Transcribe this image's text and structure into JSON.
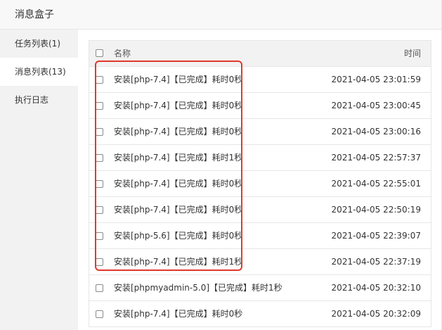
{
  "window": {
    "title": "消息盒子"
  },
  "sidebar": {
    "items": [
      {
        "label": "任务列表(1)",
        "active": false
      },
      {
        "label": "消息列表(13)",
        "active": true
      },
      {
        "label": "执行日志",
        "active": false
      }
    ]
  },
  "table": {
    "header": {
      "name": "名称",
      "time": "时间"
    },
    "rows": [
      {
        "name": "安装[php-7.4]【已完成】耗时0秒",
        "time": "2021-04-05 23:01:59"
      },
      {
        "name": "安装[php-7.4]【已完成】耗时0秒",
        "time": "2021-04-05 23:00:45"
      },
      {
        "name": "安装[php-7.4]【已完成】耗时0秒",
        "time": "2021-04-05 23:00:16"
      },
      {
        "name": "安装[php-7.4]【已完成】耗时1秒",
        "time": "2021-04-05 22:57:37"
      },
      {
        "name": "安装[php-7.4]【已完成】耗时0秒",
        "time": "2021-04-05 22:55:01"
      },
      {
        "name": "安装[php-7.4]【已完成】耗时0秒",
        "time": "2021-04-05 22:50:19"
      },
      {
        "name": "安装[php-5.6]【已完成】耗时0秒",
        "time": "2021-04-05 22:39:07"
      },
      {
        "name": "安装[php-7.4]【已完成】耗时1秒",
        "time": "2021-04-05 22:37:19"
      },
      {
        "name": "安装[phpmyadmin-5.0]【已完成】耗时1秒",
        "time": "2021-04-05 20:32:10"
      },
      {
        "name": "安装[php-7.4]【已完成】耗时0秒",
        "time": "2021-04-05 20:32:09"
      }
    ]
  },
  "annotation": {
    "color": "#e0392b"
  }
}
